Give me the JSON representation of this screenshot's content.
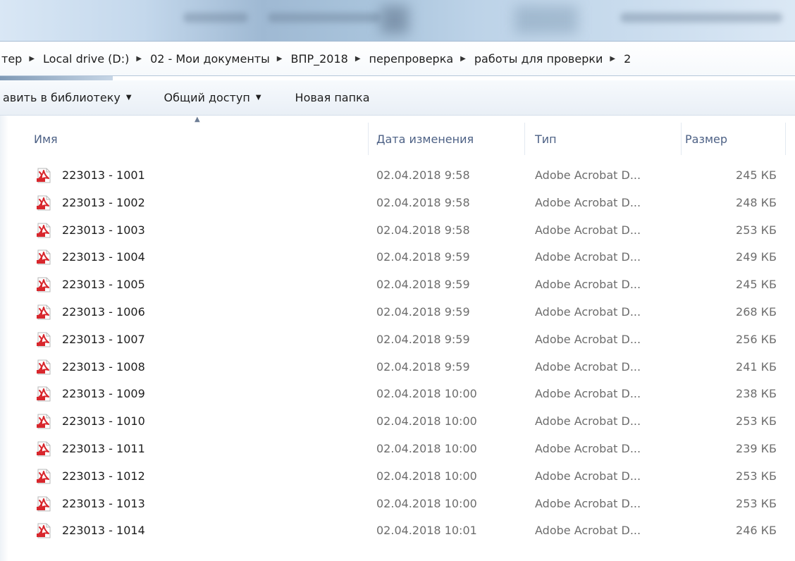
{
  "window": {
    "titlebar": ""
  },
  "breadcrumb": [
    "тер",
    "Local drive (D:)",
    "02 - Мои документы",
    "ВПР_2018",
    "перепроверка",
    "работы для проверки",
    "2"
  ],
  "toolbar": {
    "add_library": "авить в библиотеку",
    "share": "Общий доступ",
    "new_folder": "Новая папка"
  },
  "columns": {
    "name": "Имя",
    "date": "Дата изменения",
    "type": "Тип",
    "size": "Размер"
  },
  "files": [
    {
      "name": "223013 - 1001",
      "date": "02.04.2018 9:58",
      "type": "Adobe Acrobat D...",
      "size": "245 КБ"
    },
    {
      "name": "223013 - 1002",
      "date": "02.04.2018 9:58",
      "type": "Adobe Acrobat D...",
      "size": "248 КБ"
    },
    {
      "name": "223013 - 1003",
      "date": "02.04.2018 9:58",
      "type": "Adobe Acrobat D...",
      "size": "253 КБ"
    },
    {
      "name": "223013 - 1004",
      "date": "02.04.2018 9:59",
      "type": "Adobe Acrobat D...",
      "size": "249 КБ"
    },
    {
      "name": "223013 - 1005",
      "date": "02.04.2018 9:59",
      "type": "Adobe Acrobat D...",
      "size": "245 КБ"
    },
    {
      "name": "223013 - 1006",
      "date": "02.04.2018 9:59",
      "type": "Adobe Acrobat D...",
      "size": "268 КБ"
    },
    {
      "name": "223013 - 1007",
      "date": "02.04.2018 9:59",
      "type": "Adobe Acrobat D...",
      "size": "256 КБ"
    },
    {
      "name": "223013 - 1008",
      "date": "02.04.2018 9:59",
      "type": "Adobe Acrobat D...",
      "size": "241 КБ"
    },
    {
      "name": "223013 - 1009",
      "date": "02.04.2018 10:00",
      "type": "Adobe Acrobat D...",
      "size": "238 КБ"
    },
    {
      "name": "223013 - 1010",
      "date": "02.04.2018 10:00",
      "type": "Adobe Acrobat D...",
      "size": "253 КБ"
    },
    {
      "name": "223013 - 1011",
      "date": "02.04.2018 10:00",
      "type": "Adobe Acrobat D...",
      "size": "239 КБ"
    },
    {
      "name": "223013 - 1012",
      "date": "02.04.2018 10:00",
      "type": "Adobe Acrobat D...",
      "size": "253 КБ"
    },
    {
      "name": "223013 - 1013",
      "date": "02.04.2018 10:00",
      "type": "Adobe Acrobat D...",
      "size": "253 КБ"
    },
    {
      "name": "223013 - 1014",
      "date": "02.04.2018 10:01",
      "type": "Adobe Acrobat D...",
      "size": "246 КБ"
    }
  ],
  "icons": {
    "file": "pdf-file-icon",
    "breadcrumb_separator": "chevron-right-icon",
    "dropdown": "chevron-down-icon",
    "sort": "sort-up-icon"
  },
  "colors": {
    "header_text": "#4d6185",
    "secondary_text": "#6d6d6d",
    "pdf_red": "#d8262c"
  }
}
